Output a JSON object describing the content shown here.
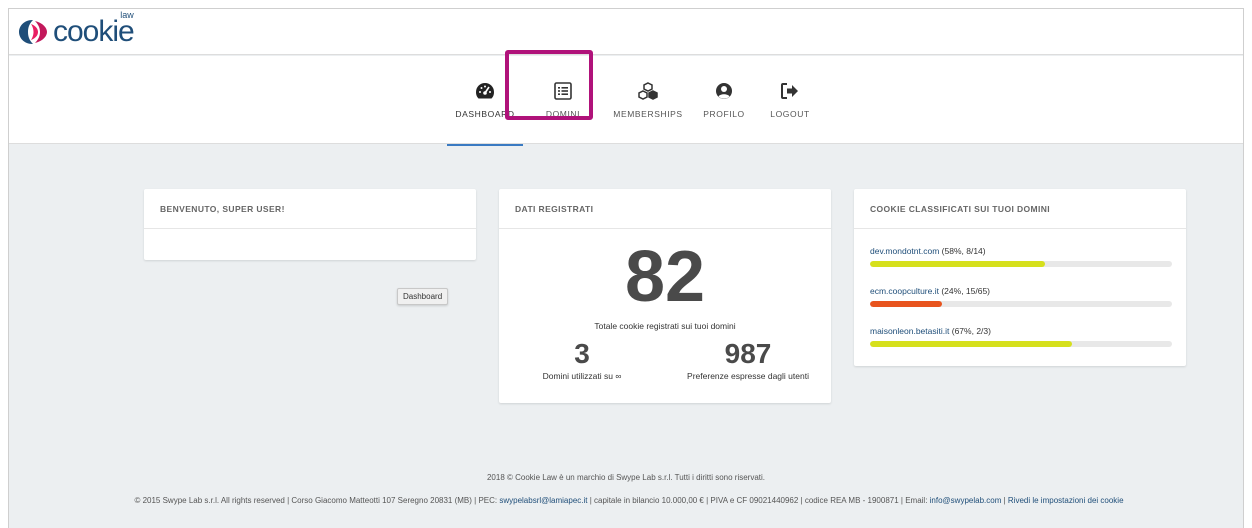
{
  "header": {
    "logo_text": "cookie",
    "logo_sup": "law"
  },
  "nav": {
    "items": [
      {
        "label": "DASHBOARD",
        "icon": "dashboard-gauge-icon",
        "active": true
      },
      {
        "label": "DOMINI",
        "icon": "list-icon",
        "active": false
      },
      {
        "label": "MEMBERSHIPS",
        "icon": "cubes-icon",
        "active": false
      },
      {
        "label": "PROFILO",
        "icon": "user-circle-icon",
        "active": false
      },
      {
        "label": "LOGOUT",
        "icon": "sign-out-icon",
        "active": false
      }
    ]
  },
  "tooltip": "Dashboard",
  "welcome_card": {
    "title": "BENVENUTO, SUPER USER!"
  },
  "stats_card": {
    "title": "DATI REGISTRATI",
    "total_cookies": "82",
    "total_label": "Totale cookie registrati sui tuoi domini",
    "domains_used": "3",
    "domains_label": "Domini utilizzati su ∞",
    "preferences": "987",
    "preferences_label": "Preferenze espresse dagli utenti"
  },
  "classified_card": {
    "title": "COOKIE CLASSIFICATI SUI TUOI DOMINI",
    "domains": [
      {
        "name": "dev.mondotnt.com",
        "stats": " (58%, 8/14)",
        "percent": 58,
        "color": "#d6e01c"
      },
      {
        "name": "ecm.coopculture.it",
        "stats": " (24%, 15/65)",
        "percent": 24,
        "color": "#e8541e"
      },
      {
        "name": "maisonleon.betasiti.it",
        "stats": " (67%, 2/3)",
        "percent": 67,
        "color": "#d6e01c"
      }
    ]
  },
  "footer": {
    "line1": "2018 © Cookie Law è un marchio di Swype Lab s.r.l. Tutti i diritti sono riservati.",
    "line2_pre": "© 2015 Swype Lab s.r.l. All rights reserved | Corso Giacomo Matteotti 107 Seregno 20831 (MB) | PEC: ",
    "pec_link": "swypelabsrl@lamiapec.it",
    "line2_mid": " | capitale in bilancio 10.000,00 € | PIVA e CF 09021440962 | codice REA MB - 1900871 | Email: ",
    "email_link": "info@swypelab.com",
    "line2_sep": " | ",
    "settings_link": "Rivedi le impostazioni dei cookie"
  }
}
